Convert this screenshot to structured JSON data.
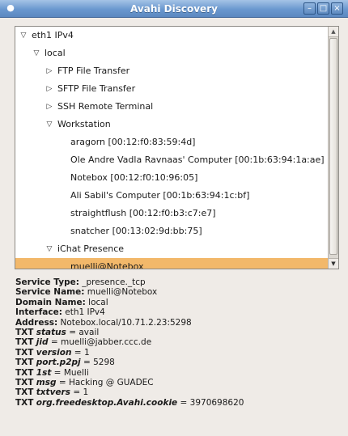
{
  "window": {
    "title": "Avahi Discovery",
    "icon": "avahi-icon",
    "buttons": {
      "minimize": "minimize-icon",
      "maximize": "maximize-icon",
      "close": "close-icon"
    }
  },
  "tree": {
    "rows": [
      {
        "label": "eth1 IPv4",
        "expander": "expanded",
        "selected": false
      },
      {
        "label": "local",
        "expander": "expanded",
        "selected": false
      },
      {
        "label": "FTP File Transfer",
        "expander": "collapsed",
        "selected": false
      },
      {
        "label": "SFTP File Transfer",
        "expander": "collapsed",
        "selected": false
      },
      {
        "label": "SSH Remote Terminal",
        "expander": "collapsed",
        "selected": false
      },
      {
        "label": "Workstation",
        "expander": "expanded",
        "selected": false
      },
      {
        "label": "aragorn [00:12:f0:83:59:4d]",
        "expander": "none",
        "selected": false
      },
      {
        "label": "Ole Andre Vadla Ravnaas' Computer [00:1b:63:94:1a:ae]",
        "expander": "none",
        "selected": false
      },
      {
        "label": "Notebox [00:12:f0:10:96:05]",
        "expander": "none",
        "selected": false
      },
      {
        "label": "Ali Sabil's Computer [00:1b:63:94:1c:bf]",
        "expander": "none",
        "selected": false
      },
      {
        "label": "straightflush [00:12:f0:b3:c7:e7]",
        "expander": "none",
        "selected": false
      },
      {
        "label": "snatcher [00:13:02:9d:bb:75]",
        "expander": "none",
        "selected": false
      },
      {
        "label": "iChat Presence",
        "expander": "expanded",
        "selected": false
      },
      {
        "label": "muelli@Notebox",
        "expander": "none",
        "selected": true
      }
    ],
    "selected_color": "#f2b86a"
  },
  "details": {
    "service_type": {
      "label": "Service Type:",
      "value": "_presence._tcp"
    },
    "service_name": {
      "label": "Service Name:",
      "value": "muelli@Notebox"
    },
    "domain_name": {
      "label": "Domain Name:",
      "value": "local"
    },
    "interface": {
      "label": "Interface:",
      "value": "eth1 IPv4"
    },
    "address": {
      "label": "Address:",
      "value": "Notebox.local/10.71.2.23:5298"
    },
    "txt_prefix": "TXT",
    "txt_records": [
      {
        "key": "status",
        "value": "avail"
      },
      {
        "key": "jid",
        "value": "muelli@jabber.ccc.de"
      },
      {
        "key": "version",
        "value": "1"
      },
      {
        "key": "port.p2pj",
        "value": "5298"
      },
      {
        "key": "1st",
        "value": "Muelli"
      },
      {
        "key": "msg",
        "value": "Hacking @ GUADEC"
      },
      {
        "key": "txtvers",
        "value": "1"
      },
      {
        "key": "org.freedesktop.Avahi.cookie",
        "value": "3970698620"
      }
    ]
  }
}
